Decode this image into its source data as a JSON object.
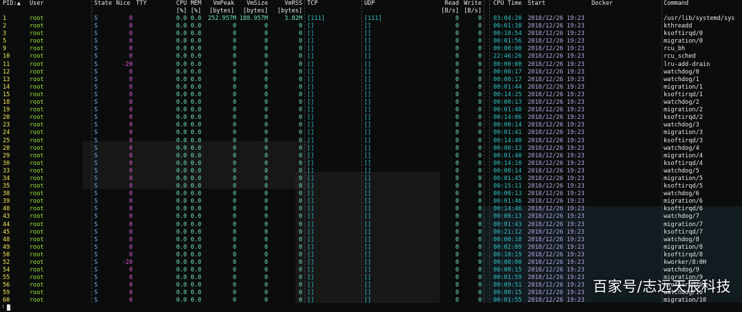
{
  "header": {
    "line1": {
      "pid": "PID:▲",
      "user": "User",
      "state": "State",
      "nice": "Nice",
      "tty": "TTY",
      "cpu": "CPU",
      "mem": "MEM",
      "vmpeak": "VmPeak",
      "vmsize": "VmSize",
      "vmrss": "VmRSS",
      "tcp": "TCP",
      "udp": "UDP",
      "read": "Read",
      "write": "Write",
      "cputime": "CPU Time",
      "start": "Start",
      "docker": "Docker",
      "command": "Command"
    },
    "line2": {
      "cpu": "[%]",
      "mem": "[%]",
      "vmpeak": "[bytes]",
      "vmsize": "[bytes]",
      "vmrss": "[bytes]",
      "read": "[B/s]",
      "write": "[B/s]"
    }
  },
  "processes": [
    {
      "pid": "1",
      "user": "root",
      "state": "S",
      "nice": "0",
      "cpu": "0.0",
      "mem": "0.0",
      "vmpeak": "252.957M",
      "vmsize": "188.957M",
      "vmrss": "3.82M",
      "tcp": "[111]",
      "udp": "[111]",
      "read": "0",
      "write": "0",
      "cputime": "03:04:20",
      "start": "2018/12/26 19:23",
      "command": "/usr/lib/systemd/sys"
    },
    {
      "pid": "2",
      "user": "root",
      "state": "S",
      "nice": "0",
      "cpu": "0.0",
      "mem": "0.0",
      "vmpeak": "0",
      "vmsize": "0",
      "vmrss": "0",
      "tcp": "[]",
      "udp": "[]",
      "read": "0",
      "write": "0",
      "cputime": "00:01:38",
      "start": "2018/12/26 19:23",
      "command": "kthreadd"
    },
    {
      "pid": "3",
      "user": "root",
      "state": "S",
      "nice": "0",
      "cpu": "0.0",
      "mem": "0.0",
      "vmpeak": "0",
      "vmsize": "0",
      "vmrss": "0",
      "tcp": "[]",
      "udp": "[]",
      "read": "0",
      "write": "0",
      "cputime": "00:18:54",
      "start": "2018/12/26 19:23",
      "command": "ksoftirqd/0"
    },
    {
      "pid": "5",
      "user": "root",
      "state": "S",
      "nice": "0",
      "cpu": "0.0",
      "mem": "0.0",
      "vmpeak": "0",
      "vmsize": "0",
      "vmrss": "0",
      "tcp": "[]",
      "udp": "[]",
      "read": "0",
      "write": "0",
      "cputime": "00:01:56",
      "start": "2018/12/26 19:23",
      "command": "migration/0"
    },
    {
      "pid": "9",
      "user": "root",
      "state": "S",
      "nice": "0",
      "cpu": "0.0",
      "mem": "0.0",
      "vmpeak": "0",
      "vmsize": "0",
      "vmrss": "0",
      "tcp": "[]",
      "udp": "[]",
      "read": "0",
      "write": "0",
      "cputime": "00:00:00",
      "start": "2018/12/26 19:23",
      "command": "rcu_bh"
    },
    {
      "pid": "10",
      "user": "root",
      "state": "S",
      "nice": "0",
      "cpu": "0.0",
      "mem": "0.0",
      "vmpeak": "0",
      "vmsize": "0",
      "vmrss": "0",
      "tcp": "[]",
      "udp": "[]",
      "read": "0",
      "write": "0",
      "cputime": "22:46:26",
      "start": "2018/12/26 19:23",
      "command": "rcu_sched"
    },
    {
      "pid": "11",
      "user": "root",
      "state": "S",
      "nice": "-20",
      "cpu": "0.0",
      "mem": "0.0",
      "vmpeak": "0",
      "vmsize": "0",
      "vmrss": "0",
      "tcp": "[]",
      "udp": "[]",
      "read": "0",
      "write": "0",
      "cputime": "00:00:00",
      "start": "2018/12/26 19:23",
      "command": "lru-add-drain"
    },
    {
      "pid": "12",
      "user": "root",
      "state": "S",
      "nice": "0",
      "cpu": "0.0",
      "mem": "0.0",
      "vmpeak": "0",
      "vmsize": "0",
      "vmrss": "0",
      "tcp": "[]",
      "udp": "[]",
      "read": "0",
      "write": "0",
      "cputime": "00:00:17",
      "start": "2018/12/26 19:23",
      "command": "watchdog/0"
    },
    {
      "pid": "13",
      "user": "root",
      "state": "S",
      "nice": "0",
      "cpu": "0.0",
      "mem": "0.0",
      "vmpeak": "0",
      "vmsize": "0",
      "vmrss": "0",
      "tcp": "[]",
      "udp": "[]",
      "read": "0",
      "write": "0",
      "cputime": "00:00:17",
      "start": "2018/12/26 19:23",
      "command": "watchdog/1"
    },
    {
      "pid": "14",
      "user": "root",
      "state": "S",
      "nice": "0",
      "cpu": "0.0",
      "mem": "0.0",
      "vmpeak": "0",
      "vmsize": "0",
      "vmrss": "0",
      "tcp": "[]",
      "udp": "[]",
      "read": "0",
      "write": "0",
      "cputime": "00:01:44",
      "start": "2018/12/26 19:23",
      "command": "migration/1"
    },
    {
      "pid": "15",
      "user": "root",
      "state": "S",
      "nice": "0",
      "cpu": "0.0",
      "mem": "0.0",
      "vmpeak": "0",
      "vmsize": "0",
      "vmrss": "0",
      "tcp": "[]",
      "udp": "[]",
      "read": "0",
      "write": "0",
      "cputime": "00:14:25",
      "start": "2018/12/26 19:23",
      "command": "ksoftirqd/1"
    },
    {
      "pid": "18",
      "user": "root",
      "state": "S",
      "nice": "0",
      "cpu": "0.0",
      "mem": "0.0",
      "vmpeak": "0",
      "vmsize": "0",
      "vmrss": "0",
      "tcp": "[]",
      "udp": "[]",
      "read": "0",
      "write": "0",
      "cputime": "00:00:13",
      "start": "2018/12/26 19:23",
      "command": "watchdog/2"
    },
    {
      "pid": "19",
      "user": "root",
      "state": "S",
      "nice": "0",
      "cpu": "0.0",
      "mem": "0.0",
      "vmpeak": "0",
      "vmsize": "0",
      "vmrss": "0",
      "tcp": "[]",
      "udp": "[]",
      "read": "0",
      "write": "0",
      "cputime": "00:01:40",
      "start": "2018/12/26 19:23",
      "command": "migration/2"
    },
    {
      "pid": "20",
      "user": "root",
      "state": "S",
      "nice": "0",
      "cpu": "0.0",
      "mem": "0.0",
      "vmpeak": "0",
      "vmsize": "0",
      "vmrss": "0",
      "tcp": "[]",
      "udp": "[]",
      "read": "0",
      "write": "0",
      "cputime": "00:14:06",
      "start": "2018/12/26 19:23",
      "command": "ksoftirqd/2"
    },
    {
      "pid": "23",
      "user": "root",
      "state": "S",
      "nice": "0",
      "cpu": "0.0",
      "mem": "0.0",
      "vmpeak": "0",
      "vmsize": "0",
      "vmrss": "0",
      "tcp": "[]",
      "udp": "[]",
      "read": "0",
      "write": "0",
      "cputime": "00:00:14",
      "start": "2018/12/26 19:23",
      "command": "watchdog/3"
    },
    {
      "pid": "24",
      "user": "root",
      "state": "S",
      "nice": "0",
      "cpu": "0.0",
      "mem": "0.0",
      "vmpeak": "0",
      "vmsize": "0",
      "vmrss": "0",
      "tcp": "[]",
      "udp": "[]",
      "read": "0",
      "write": "0",
      "cputime": "00:01:41",
      "start": "2018/12/26 19:23",
      "command": "migration/3"
    },
    {
      "pid": "25",
      "user": "root",
      "state": "S",
      "nice": "0",
      "cpu": "0.0",
      "mem": "0.0",
      "vmpeak": "0",
      "vmsize": "0",
      "vmrss": "0",
      "tcp": "[]",
      "udp": "[]",
      "read": "0",
      "write": "0",
      "cputime": "00:14:40",
      "start": "2018/12/26 19:23",
      "command": "ksoftirqd/3"
    },
    {
      "pid": "28",
      "user": "root",
      "state": "S",
      "nice": "0",
      "cpu": "0.0",
      "mem": "0.0",
      "vmpeak": "0",
      "vmsize": "0",
      "vmrss": "0",
      "tcp": "[]",
      "udp": "[]",
      "read": "0",
      "write": "0",
      "cputime": "00:00:13",
      "start": "2018/12/26 19:23",
      "command": "watchdog/4"
    },
    {
      "pid": "29",
      "user": "root",
      "state": "S",
      "nice": "0",
      "cpu": "0.0",
      "mem": "0.0",
      "vmpeak": "0",
      "vmsize": "0",
      "vmrss": "0",
      "tcp": "[]",
      "udp": "[]",
      "read": "0",
      "write": "0",
      "cputime": "00:01:40",
      "start": "2018/12/26 19:23",
      "command": "migration/4"
    },
    {
      "pid": "30",
      "user": "root",
      "state": "S",
      "nice": "0",
      "cpu": "0.0",
      "mem": "0.0",
      "vmpeak": "0",
      "vmsize": "0",
      "vmrss": "0",
      "tcp": "[]",
      "udp": "[]",
      "read": "0",
      "write": "0",
      "cputime": "00:14:10",
      "start": "2018/12/26 19:23",
      "command": "ksoftirqd/4"
    },
    {
      "pid": "33",
      "user": "root",
      "state": "S",
      "nice": "0",
      "cpu": "0.0",
      "mem": "0.0",
      "vmpeak": "0",
      "vmsize": "0",
      "vmrss": "0",
      "tcp": "[]",
      "udp": "[]",
      "read": "0",
      "write": "0",
      "cputime": "00:00:14",
      "start": "2018/12/26 19:23",
      "command": "watchdog/5"
    },
    {
      "pid": "34",
      "user": "root",
      "state": "S",
      "nice": "0",
      "cpu": "0.0",
      "mem": "0.0",
      "vmpeak": "0",
      "vmsize": "0",
      "vmrss": "0",
      "tcp": "[]",
      "udp": "[]",
      "read": "0",
      "write": "0",
      "cputime": "00:01:45",
      "start": "2018/12/26 19:23",
      "command": "migration/5"
    },
    {
      "pid": "35",
      "user": "root",
      "state": "S",
      "nice": "0",
      "cpu": "0.0",
      "mem": "0.0",
      "vmpeak": "0",
      "vmsize": "0",
      "vmrss": "0",
      "tcp": "[]",
      "udp": "[]",
      "read": "0",
      "write": "0",
      "cputime": "00:15:11",
      "start": "2018/12/26 19:23",
      "command": "ksoftirqd/5"
    },
    {
      "pid": "38",
      "user": "root",
      "state": "S",
      "nice": "0",
      "cpu": "0.0",
      "mem": "0.0",
      "vmpeak": "0",
      "vmsize": "0",
      "vmrss": "0",
      "tcp": "[]",
      "udp": "[]",
      "read": "0",
      "write": "0",
      "cputime": "00:00:13",
      "start": "2018/12/26 19:23",
      "command": "watchdog/6"
    },
    {
      "pid": "39",
      "user": "root",
      "state": "S",
      "nice": "0",
      "cpu": "0.0",
      "mem": "0.0",
      "vmpeak": "0",
      "vmsize": "0",
      "vmrss": "0",
      "tcp": "[]",
      "udp": "[]",
      "read": "0",
      "write": "0",
      "cputime": "00:01:46",
      "start": "2018/12/26 19:23",
      "command": "migration/6"
    },
    {
      "pid": "40",
      "user": "root",
      "state": "S",
      "nice": "0",
      "cpu": "0.0",
      "mem": "0.0",
      "vmpeak": "0",
      "vmsize": "0",
      "vmrss": "0",
      "tcp": "[]",
      "udp": "[]",
      "read": "0",
      "write": "0",
      "cputime": "00:14:46",
      "start": "2018/12/26 19:23",
      "command": "ksoftirqd/6"
    },
    {
      "pid": "43",
      "user": "root",
      "state": "S",
      "nice": "0",
      "cpu": "0.0",
      "mem": "0.0",
      "vmpeak": "0",
      "vmsize": "0",
      "vmrss": "0",
      "tcp": "[]",
      "udp": "[]",
      "read": "0",
      "write": "0",
      "cputime": "00:00:13",
      "start": "2018/12/26 19:23",
      "command": "watchdog/7"
    },
    {
      "pid": "44",
      "user": "root",
      "state": "S",
      "nice": "0",
      "cpu": "0.0",
      "mem": "0.0",
      "vmpeak": "0",
      "vmsize": "0",
      "vmrss": "0",
      "tcp": "[]",
      "udp": "[]",
      "read": "0",
      "write": "0",
      "cputime": "00:01:43",
      "start": "2018/12/26 19:23",
      "command": "migration/7"
    },
    {
      "pid": "45",
      "user": "root",
      "state": "S",
      "nice": "0",
      "cpu": "0.0",
      "mem": "0.0",
      "vmpeak": "0",
      "vmsize": "0",
      "vmrss": "0",
      "tcp": "[]",
      "udp": "[]",
      "read": "0",
      "write": "0",
      "cputime": "00:21:12",
      "start": "2018/12/26 19:23",
      "command": "ksoftirqd/7"
    },
    {
      "pid": "48",
      "user": "root",
      "state": "S",
      "nice": "0",
      "cpu": "0.0",
      "mem": "0.0",
      "vmpeak": "0",
      "vmsize": "0",
      "vmrss": "0",
      "tcp": "[]",
      "udp": "[]",
      "read": "0",
      "write": "0",
      "cputime": "00:00:18",
      "start": "2018/12/26 19:23",
      "command": "watchdog/8"
    },
    {
      "pid": "49",
      "user": "root",
      "state": "S",
      "nice": "0",
      "cpu": "0.0",
      "mem": "0.0",
      "vmpeak": "0",
      "vmsize": "0",
      "vmrss": "0",
      "tcp": "[]",
      "udp": "[]",
      "read": "0",
      "write": "0",
      "cputime": "00:02:09",
      "start": "2018/12/26 19:23",
      "command": "migration/8"
    },
    {
      "pid": "50",
      "user": "root",
      "state": "S",
      "nice": "0",
      "cpu": "0.0",
      "mem": "0.0",
      "vmpeak": "0",
      "vmsize": "0",
      "vmrss": "0",
      "tcp": "[]",
      "udp": "[]",
      "read": "0",
      "write": "0",
      "cputime": "00:10:19",
      "start": "2018/12/26 19:23",
      "command": "ksoftirqd/8"
    },
    {
      "pid": "52",
      "user": "root",
      "state": "S",
      "nice": "-20",
      "cpu": "0.0",
      "mem": "0.0",
      "vmpeak": "0",
      "vmsize": "0",
      "vmrss": "0",
      "tcp": "[]",
      "udp": "[]",
      "read": "0",
      "write": "0",
      "cputime": "00:00:00",
      "start": "2018/12/26 19:23",
      "command": "kworker/8:0H"
    },
    {
      "pid": "54",
      "user": "root",
      "state": "S",
      "nice": "0",
      "cpu": "0.0",
      "mem": "0.0",
      "vmpeak": "0",
      "vmsize": "0",
      "vmrss": "0",
      "tcp": "[]",
      "udp": "[]",
      "read": "0",
      "write": "0",
      "cputime": "00:00:15",
      "start": "2018/12/26 19:23",
      "command": "watchdog/9"
    },
    {
      "pid": "55",
      "user": "root",
      "state": "S",
      "nice": "0",
      "cpu": "0.0",
      "mem": "0.0",
      "vmpeak": "0",
      "vmsize": "0",
      "vmrss": "0",
      "tcp": "[]",
      "udp": "[]",
      "read": "0",
      "write": "0",
      "cputime": "00:01:59",
      "start": "2018/12/26 19:23",
      "command": "migration/9"
    },
    {
      "pid": "56",
      "user": "root",
      "state": "S",
      "nice": "0",
      "cpu": "0.0",
      "mem": "0.0",
      "vmpeak": "0",
      "vmsize": "0",
      "vmrss": "0",
      "tcp": "[]",
      "udp": "[]",
      "read": "0",
      "write": "0",
      "cputime": "00:09:51",
      "start": "2018/12/26 19:23",
      "command": "ksoftirqd/9"
    },
    {
      "pid": "59",
      "user": "root",
      "state": "S",
      "nice": "0",
      "cpu": "0.0",
      "mem": "0.0",
      "vmpeak": "0",
      "vmsize": "0",
      "vmrss": "0",
      "tcp": "[]",
      "udp": "[]",
      "read": "0",
      "write": "0",
      "cputime": "00:00:15",
      "start": "2018/12/26 19:23",
      "command": "watchdog/10"
    },
    {
      "pid": "60",
      "user": "root",
      "state": "S",
      "nice": "0",
      "cpu": "0.0",
      "mem": "0.0",
      "vmpeak": "0",
      "vmsize": "0",
      "vmrss": "0",
      "tcp": "[]",
      "udp": "[]",
      "read": "0",
      "write": "0",
      "cputime": "00:01:55",
      "start": "2018/12/26 19:23",
      "command": "migration/10"
    }
  ],
  "prompt": ":",
  "watermark": "百家号/志远天辰科技",
  "colors": {
    "background": "#0b0d0c",
    "pid": "#f2e55a",
    "user": "#9be23a",
    "state": "#76b6ef",
    "nice": "#e05bd6",
    "numbers": "#6fe0c8",
    "network": "#2fc3c7",
    "start": "#b8a9e6",
    "text": "#e8e8e8"
  }
}
